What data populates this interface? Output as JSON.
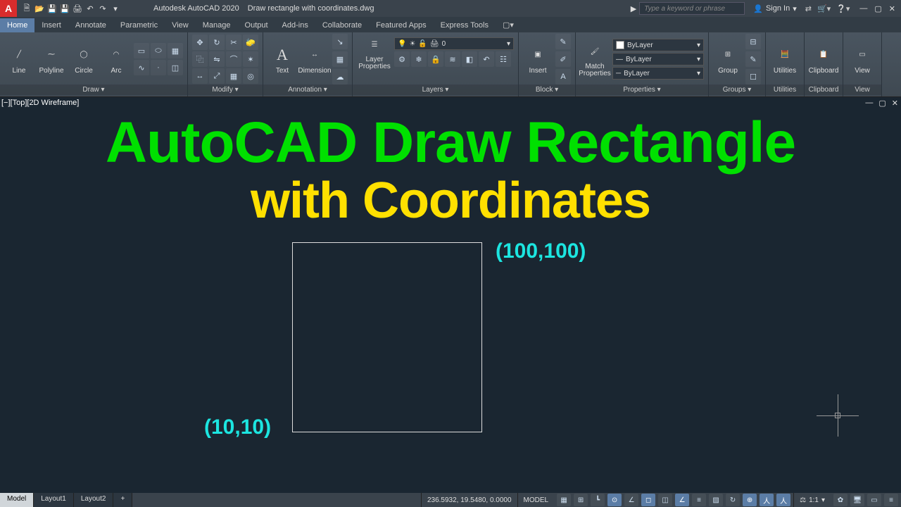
{
  "titlebar": {
    "app_letter": "A",
    "app_name": "Autodesk AutoCAD 2020",
    "file_name": "Draw rectangle with coordinates.dwg",
    "search_placeholder": "Type a keyword or phrase",
    "signin": "Sign In"
  },
  "ribbon": {
    "tabs": [
      "Home",
      "Insert",
      "Annotate",
      "Parametric",
      "View",
      "Manage",
      "Output",
      "Add-ins",
      "Collaborate",
      "Featured Apps",
      "Express Tools"
    ],
    "active_tab": "Home",
    "draw": {
      "title": "Draw ▾",
      "line": "Line",
      "polyline": "Polyline",
      "circle": "Circle",
      "arc": "Arc"
    },
    "modify": {
      "title": "Modify ▾"
    },
    "annotation": {
      "title": "Annotation ▾",
      "text": "Text",
      "dimension": "Dimension"
    },
    "layers": {
      "title": "Layers ▾",
      "layerprops": "Layer\nProperties",
      "current": "0"
    },
    "block": {
      "title": "Block ▾",
      "insert": "Insert"
    },
    "properties": {
      "title": "Properties ▾",
      "match": "Match\nProperties",
      "bylayer": "ByLayer"
    },
    "groups": {
      "title": "Groups ▾",
      "group": "Group"
    },
    "utilities": {
      "title": "Utilities"
    },
    "clipboard": {
      "title": "Clipboard"
    },
    "view": {
      "title": "View"
    }
  },
  "canvas": {
    "view_label": "[−][Top][2D Wireframe]",
    "heading1": "AutoCAD Draw Rectangle",
    "heading2": "with Coordinates",
    "coord_topright": "(100,100)",
    "coord_bottomleft": "(10,10)"
  },
  "status": {
    "tabs": [
      "Model",
      "Layout1",
      "Layout2"
    ],
    "active_tab": "Model",
    "coords": "236.5932, 19.5480, 0.0000",
    "space": "MODEL",
    "scale": "1:1",
    "plus": "+"
  }
}
